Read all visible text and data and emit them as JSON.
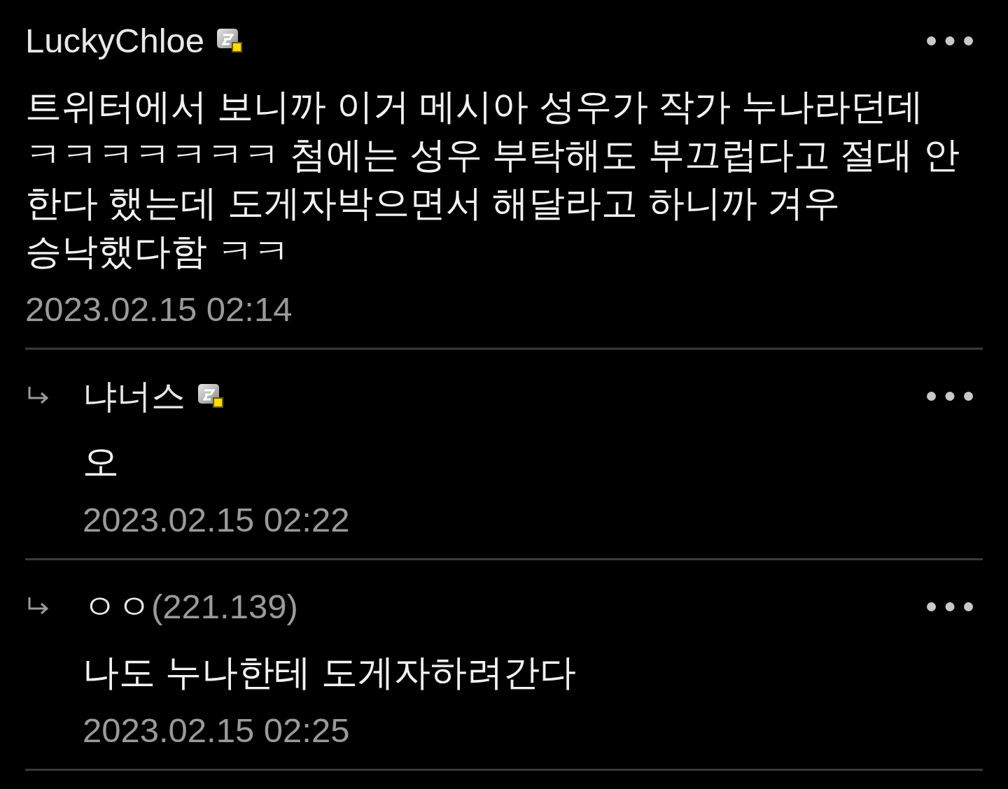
{
  "comments": [
    {
      "kind": "member",
      "author": "LuckyChloe",
      "text": "트위터에서 보니까 이거 메시아 성우가 작가 누나라던데 ㅋㅋㅋㅋㅋㅋㅋ 첨에는 성우 부탁해도 부끄럽다고 절대 안 한다 했는데 도게자박으면서 해달라고 하니까 겨우 승낙했다함 ㅋㅋ",
      "date": "2023.02.15 02:14",
      "replies": [
        {
          "kind": "member",
          "author": "냐너스",
          "text": "오",
          "date": "2023.02.15 02:22"
        },
        {
          "kind": "guest",
          "author": "ㅇㅇ",
          "ip": "(221.139)",
          "text": "나도 누나한테 도게자하려간다",
          "date": "2023.02.15 02:25"
        }
      ]
    }
  ]
}
